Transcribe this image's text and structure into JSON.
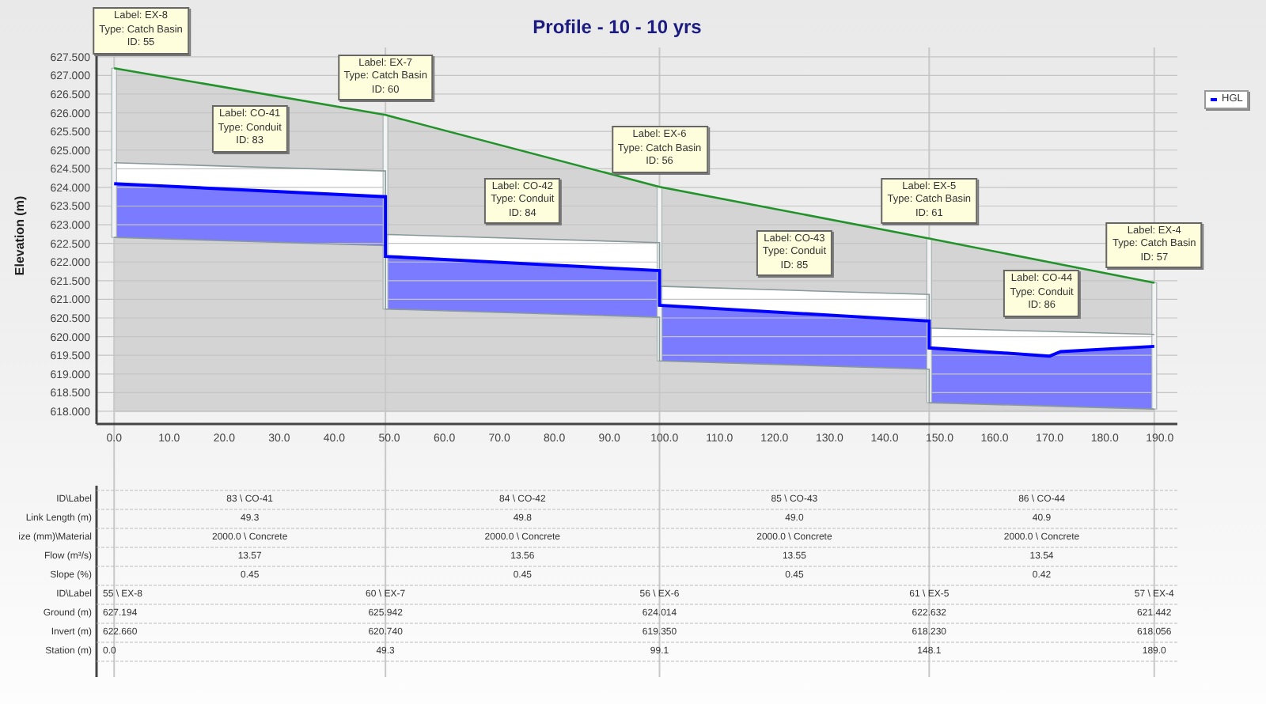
{
  "chart": {
    "chart_data": {
      "type": "line",
      "title": "Profile - 10 - 10 yrs",
      "ylabel": "Elevation (m)",
      "grid": true,
      "x": [
        0,
        49.3,
        49.3,
        99.1,
        99.1,
        148.1,
        148.1,
        170,
        172,
        189.0
      ],
      "series": [
        {
          "color": "#22922a",
          "values": [
            627.194,
            625.942,
            625.942,
            624.014,
            624.014,
            622.632,
            622.632,
            621.995,
            621.937,
            621.442
          ]
        },
        {
          "color": "#8a9a9a",
          "values": [
            624.66,
            624.44,
            622.74,
            622.52,
            621.35,
            621.13,
            620.23,
            620.14,
            620.13,
            620.06
          ]
        },
        {
          "color": "#8a9a9a",
          "values": [
            622.66,
            622.44,
            620.74,
            620.52,
            619.35,
            619.13,
            618.23,
            618.14,
            618.13,
            618.06
          ]
        },
        {
          "name": "HGL",
          "color": "#0000ff",
          "values": [
            624.1,
            623.75,
            622.15,
            621.77,
            620.84,
            620.42,
            619.7,
            619.48,
            619.6,
            619.74
          ]
        }
      ],
      "xlim": [
        -3.2,
        193.2
      ],
      "ylim": [
        617.66,
        627.75
      ],
      "xticks": [
        {
          "value": 0,
          "label": "0.0"
        },
        {
          "value": 10,
          "label": "10.0"
        },
        {
          "value": 20,
          "label": "20.0"
        },
        {
          "value": 30,
          "label": "30.0"
        },
        {
          "value": 40,
          "label": "40.0"
        },
        {
          "value": 50,
          "label": "50.0"
        },
        {
          "value": 60,
          "label": "60.0"
        },
        {
          "value": 70,
          "label": "70.0"
        },
        {
          "value": 80,
          "label": "80.0"
        },
        {
          "value": 90,
          "label": "90.0"
        },
        {
          "value": 100,
          "label": "100.0"
        },
        {
          "value": 110,
          "label": "110.0"
        },
        {
          "value": 120,
          "label": "120.0"
        },
        {
          "value": 130,
          "label": "130.0"
        },
        {
          "value": 140,
          "label": "140.0"
        },
        {
          "value": 150,
          "label": "150.0"
        },
        {
          "value": 160,
          "label": "160.0"
        },
        {
          "value": 170,
          "label": "170.0"
        },
        {
          "value": 180,
          "label": "180.0"
        },
        {
          "value": 190,
          "label": "190.0"
        }
      ],
      "yticks": [
        {
          "value": 618,
          "label": "618.000"
        },
        {
          "value": 618.5,
          "label": "618.500"
        },
        {
          "value": 619,
          "label": "619.000"
        },
        {
          "value": 619.5,
          "label": "619.500"
        },
        {
          "value": 620,
          "label": "620.000"
        },
        {
          "value": 620.5,
          "label": "620.500"
        },
        {
          "value": 621,
          "label": "621.000"
        },
        {
          "value": 621.5,
          "label": "621.500"
        },
        {
          "value": 622,
          "label": "622.000"
        },
        {
          "value": 622.5,
          "label": "622.500"
        },
        {
          "value": 623,
          "label": "623.000"
        },
        {
          "value": 623.5,
          "label": "623.500"
        },
        {
          "value": 624,
          "label": "624.000"
        },
        {
          "value": 624.5,
          "label": "624.500"
        },
        {
          "value": 625,
          "label": "625.000"
        },
        {
          "value": 625.5,
          "label": "625.500"
        },
        {
          "value": 626,
          "label": "626.000"
        },
        {
          "value": 626.5,
          "label": "626.500"
        },
        {
          "value": 627,
          "label": "627.000"
        },
        {
          "value": 627.5,
          "label": "627.500"
        }
      ],
      "annotations": [
        "Label: EX-8\nType: Catch Basin\nID: 55",
        "Label: CO-41\nType: Conduit\nID: 83",
        "Label: EX-7\nType: Catch Basin\nID: 60",
        "Label: CO-42\nType: Conduit\nID: 84",
        "Label: EX-6\nType: Catch Basin\nID: 56",
        "Label: CO-43\nType: Conduit\nID: 85",
        "Label: EX-5\nType: Catch Basin\nID: 61",
        "Label: CO-44\nType: Conduit\nID: 86",
        "Label: EX-4\nType: Catch Basin\nID: 57"
      ]
    }
  },
  "table": {
    "rows": [
      {
        "label": "ID\\Label",
        "kind": "link",
        "cells": [
          "83 \\ CO-41",
          "84 \\ CO-42",
          "85 \\ CO-43",
          "86 \\ CO-44"
        ]
      },
      {
        "label": "Link Length (m)",
        "kind": "link",
        "cells": [
          "49.3",
          "49.8",
          "49.0",
          "40.9"
        ]
      },
      {
        "label": "ize (mm)\\Material",
        "kind": "link",
        "cells": [
          "2000.0 \\ Concrete",
          "2000.0 \\ Concrete",
          "2000.0 \\ Concrete",
          "2000.0 \\ Concrete"
        ]
      },
      {
        "label": "Flow (m³/s)",
        "kind": "link",
        "cells": [
          "13.57",
          "13.56",
          "13.55",
          "13.54"
        ]
      },
      {
        "label": "Slope (%)",
        "kind": "link",
        "cells": [
          "0.45",
          "0.45",
          "0.45",
          "0.42"
        ]
      },
      {
        "label": "ID\\Label",
        "kind": "node",
        "cells": [
          "55 \\ EX-8",
          "60 \\ EX-7",
          "56 \\ EX-6",
          "61 \\ EX-5",
          "57 \\ EX-4"
        ]
      },
      {
        "label": "Ground (m)",
        "kind": "node",
        "cells": [
          "627.194",
          "625.942",
          "624.014",
          "622.632",
          "621.442"
        ]
      },
      {
        "label": "Invert (m)",
        "kind": "node",
        "cells": [
          "622.660",
          "620.740",
          "619.350",
          "618.230",
          "618.056"
        ]
      },
      {
        "label": "Station (m)",
        "kind": "node",
        "cells": [
          "0.0",
          "49.3",
          "99.1",
          "148.1",
          "189.0"
        ]
      }
    ]
  }
}
